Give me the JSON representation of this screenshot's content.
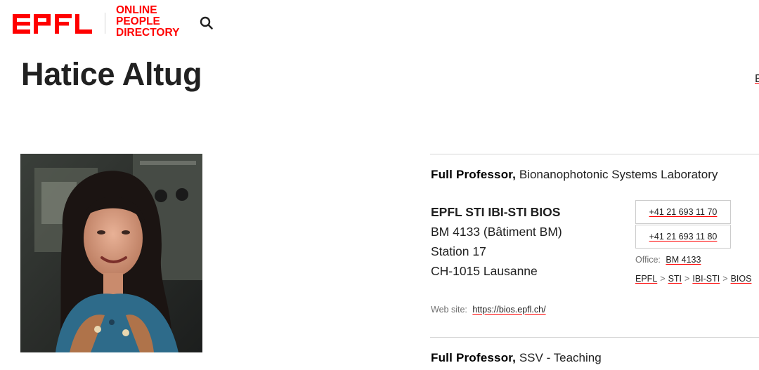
{
  "header": {
    "logo_text": "EPFL",
    "site_title_lines": [
      "ONLINE",
      "PEOPLE",
      "DIRECTORY"
    ],
    "brand_color": "#ff0000",
    "search_icon": "search-icon"
  },
  "person": {
    "name": "Hatice Altug",
    "photo_alt": "Hatice Altug"
  },
  "positions": [
    {
      "title": "Full Professor,",
      "unit_name": "Bionanophotonic Systems Laboratory",
      "address": {
        "unit": "EPFL STI IBI-STI BIOS",
        "line1": "BM 4133 (Bâtiment BM)",
        "line2": "Station 17",
        "line3": "CH-1015 Lausanne"
      },
      "phones": [
        "+41 21 693 11 70",
        "+41 21 693 11 80"
      ],
      "office_label": "Office:",
      "office_value": "BM 4133",
      "breadcrumb": [
        "EPFL",
        "STI",
        "IBI-STI",
        "BIOS"
      ],
      "breadcrumb_sep": ">",
      "website_label": "Web site:",
      "website_url": "https://bios.epfl.ch/"
    },
    {
      "title": "Full Professor,",
      "unit_name": "SSV - Teaching"
    }
  ]
}
